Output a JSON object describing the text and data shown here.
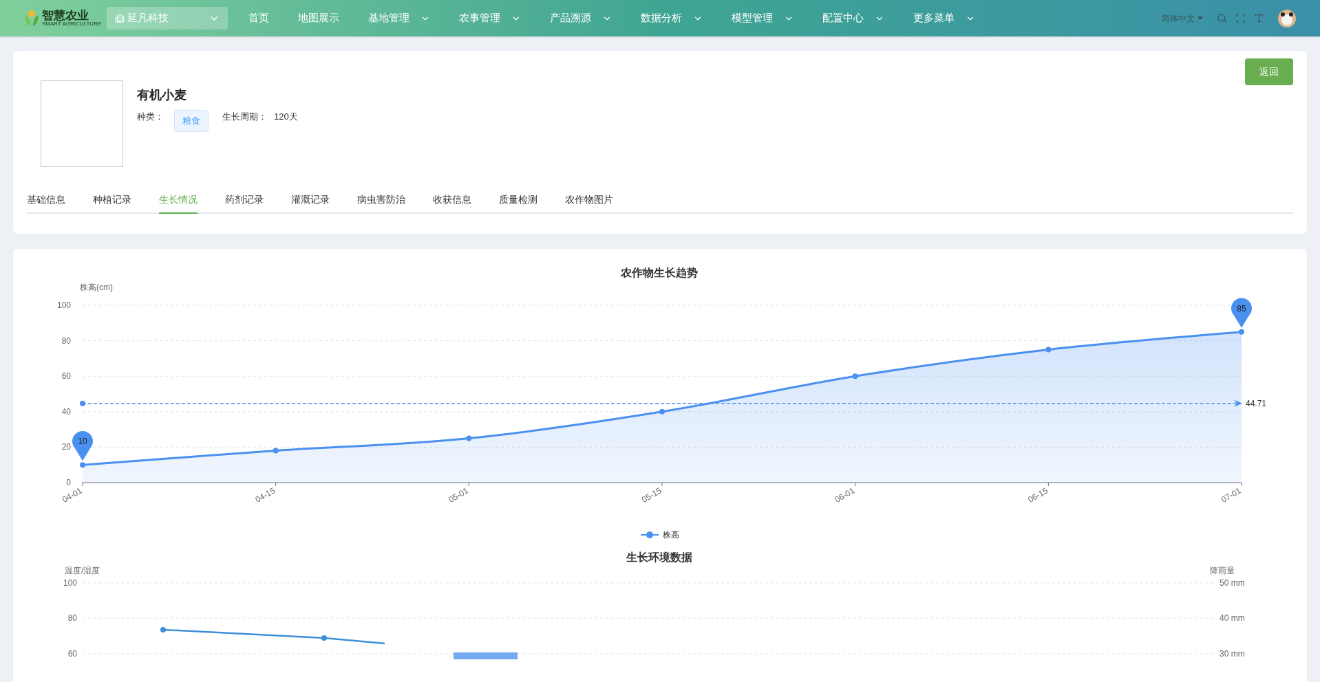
{
  "nav": {
    "logo_title": "智慧农业",
    "logo_subtitle": "SMART AGRICULTURE",
    "org_select": "延凡科技",
    "language": "简体中文",
    "menu": [
      {
        "label": "首页",
        "has_submenu": false
      },
      {
        "label": "地图展示",
        "has_submenu": false
      },
      {
        "label": "基地管理",
        "has_submenu": true
      },
      {
        "label": "农事管理",
        "has_submenu": true
      },
      {
        "label": "产品溯源",
        "has_submenu": true
      },
      {
        "label": "数据分析",
        "has_submenu": true
      },
      {
        "label": "模型管理",
        "has_submenu": true
      },
      {
        "label": "配置中心",
        "has_submenu": true
      },
      {
        "label": "更多菜单",
        "has_submenu": true
      }
    ]
  },
  "product": {
    "name": "有机小麦",
    "category_label": "种类：",
    "category": "粮食",
    "cycle_label": "生长周期：",
    "cycle": "120天",
    "back_button": "返回"
  },
  "tabs": [
    {
      "label": "基础信息",
      "selected": false
    },
    {
      "label": "种植记录",
      "selected": false
    },
    {
      "label": "生长情况",
      "selected": true
    },
    {
      "label": "药剂记录",
      "selected": false
    },
    {
      "label": "灌溉记录",
      "selected": false
    },
    {
      "label": "病虫害防治",
      "selected": false
    },
    {
      "label": "收获信息",
      "selected": false
    },
    {
      "label": "质量检测",
      "selected": false
    },
    {
      "label": "农作物图片",
      "selected": false
    }
  ],
  "growth_chart": {
    "chart_data": {
      "type": "area",
      "title": "农作物生长趋势",
      "ylabel": "株高(cm)",
      "categories": [
        "04-01",
        "04-15",
        "05-01",
        "05-15",
        "06-01",
        "06-15",
        "07-01"
      ],
      "series": [
        {
          "name": "株高",
          "color": "#4a90f0",
          "values": [
            10,
            18,
            25,
            40,
            60,
            75,
            85
          ]
        }
      ],
      "ylim": [
        0,
        100
      ],
      "yticks": [
        0,
        20,
        40,
        60,
        80,
        100
      ],
      "grid": true,
      "annotations": [
        {
          "x": "04-01",
          "y": 10,
          "text": "10"
        },
        {
          "x": "07-01",
          "y": 85,
          "text": "85"
        }
      ],
      "ref_lines": [
        {
          "axis": "y",
          "value": 44.71,
          "label": "44.71",
          "color": "#4a90f0"
        }
      ]
    }
  },
  "env_chart": {
    "title": "生长环境数据",
    "left_axis_label": "温度/湿度",
    "right_axis_label": "降雨量",
    "left_ticks": [
      "100",
      "80",
      "60"
    ],
    "right_ticks": [
      "50 mm",
      "40 mm",
      "30 mm"
    ]
  }
}
